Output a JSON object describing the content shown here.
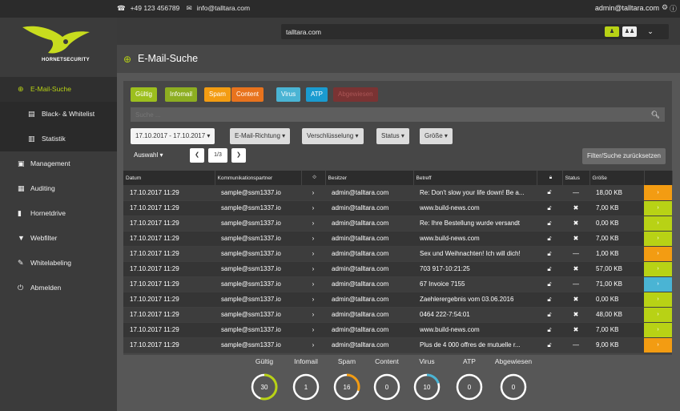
{
  "topbar": {
    "phone": "+49 123 456789",
    "email": "info@talltara.com",
    "user": "admin@talltara.com"
  },
  "logo": {
    "brand": "HORNETSECURITY"
  },
  "nav": [
    {
      "label": "E-Mail-Suche",
      "icon": "search-icon",
      "active": true
    },
    {
      "label": "Black- & Whitelist",
      "icon": "list-icon",
      "sub": true
    },
    {
      "label": "Statistik",
      "icon": "bar-chart-icon",
      "sub": true
    },
    {
      "label": "Management",
      "icon": "id-card-icon"
    },
    {
      "label": "Auditing",
      "icon": "table-icon"
    },
    {
      "label": "Hornetdrive",
      "icon": "file-icon"
    },
    {
      "label": "Webfilter",
      "icon": "filter-icon"
    },
    {
      "label": "Whitelabeling",
      "icon": "edit-icon"
    },
    {
      "label": "Abmelden",
      "icon": "power-icon"
    }
  ],
  "domain": "talltara.com",
  "page_title": "E-Mail-Suche",
  "filters": [
    {
      "label": "Gültig",
      "color": "#9cbf1e"
    },
    {
      "label": "Infomail",
      "color": "#8dae21"
    },
    {
      "label": "Spam",
      "color": "#f39c12"
    },
    {
      "label": "Content",
      "color": "#e8731d"
    },
    {
      "label": "Virus",
      "color": "#4ab4d4"
    },
    {
      "label": "ATP",
      "color": "#1a9bd0"
    },
    {
      "label": "Abgewiesen",
      "color": "#7a3333"
    }
  ],
  "search": {
    "placeholder": "Suche ..."
  },
  "dropdowns": [
    "17.10.2017 - 17.10.2017",
    "E-Mail-Richtung",
    "Verschlüsselung",
    "Status",
    "Größe"
  ],
  "auswahl": "Auswahl",
  "pager": {
    "page": "1/3"
  },
  "reset": "Filter/Suche zurücksetzen",
  "columns": [
    "Datum",
    "Kommunikationspartner",
    "",
    "Besitzer",
    "Betreff",
    "",
    "Status",
    "Größe",
    ""
  ],
  "rows": [
    {
      "date": "17.10.2017 11:29",
      "partner": "sample@ssm1337.io",
      "owner": "admin@talltara.com",
      "subject": "Re: Don't slow your life down! Be a...",
      "status": "—",
      "size": "18,00 KB",
      "color": "#f39c12"
    },
    {
      "date": "17.10.2017 11:29",
      "partner": "sample@ssm1337.io",
      "owner": "admin@talltara.com",
      "subject": "www.build-news.com",
      "status": "✖",
      "size": "7,00 KB",
      "color": "#b8d215"
    },
    {
      "date": "17.10.2017 11:29",
      "partner": "sample@ssm1337.io",
      "owner": "admin@talltara.com",
      "subject": "Re: Ihre Bestellung wurde versandt",
      "status": "✖",
      "size": "0,00 KB",
      "color": "#b8d215"
    },
    {
      "date": "17.10.2017 11:29",
      "partner": "sample@ssm1337.io",
      "owner": "admin@talltara.com",
      "subject": "www.build-news.com",
      "status": "✖",
      "size": "7,00 KB",
      "color": "#b8d215"
    },
    {
      "date": "17.10.2017 11:29",
      "partner": "sample@ssm1337.io",
      "owner": "admin@talltara.com",
      "subject": "Sex und Weihnachten! Ich will dich!",
      "status": "—",
      "size": "1,00 KB",
      "color": "#f39c12"
    },
    {
      "date": "17.10.2017 11:29",
      "partner": "sample@ssm1337.io",
      "owner": "admin@talltara.com",
      "subject": "703 917-10:21:25",
      "status": "✖",
      "size": "57,00 KB",
      "color": "#b8d215"
    },
    {
      "date": "17.10.2017 11:29",
      "partner": "sample@ssm1337.io",
      "owner": "admin@talltara.com",
      "subject": "67 Invoice 7155",
      "status": "—",
      "size": "71,00 KB",
      "color": "#4ab4d4"
    },
    {
      "date": "17.10.2017 11:29",
      "partner": "sample@ssm1337.io",
      "owner": "admin@talltara.com",
      "subject": "Zaehlerergebnis vom 03.06.2016",
      "status": "✖",
      "size": "0,00 KB",
      "color": "#b8d215"
    },
    {
      "date": "17.10.2017 11:29",
      "partner": "sample@ssm1337.io",
      "owner": "admin@talltara.com",
      "subject": "0464 222-7:54:01",
      "status": "✖",
      "size": "48,00 KB",
      "color": "#b8d215"
    },
    {
      "date": "17.10.2017 11:29",
      "partner": "sample@ssm1337.io",
      "owner": "admin@talltara.com",
      "subject": "www.build-news.com",
      "status": "✖",
      "size": "7,00 KB",
      "color": "#b8d215"
    },
    {
      "date": "17.10.2017 11:29",
      "partner": "sample@ssm1337.io",
      "owner": "admin@talltara.com",
      "subject": "Plus de 4 000 offres de mutuelle r...",
      "status": "—",
      "size": "9,00 KB",
      "color": "#f39c12"
    }
  ],
  "stats": [
    {
      "label": "Gültig",
      "value": "30",
      "fraction": 0.55,
      "color": "#b8d215"
    },
    {
      "label": "Infomail",
      "value": "1",
      "fraction": 0,
      "color": "#b8d215"
    },
    {
      "label": "Spam",
      "value": "16",
      "fraction": 0.3,
      "color": "#f39c12"
    },
    {
      "label": "Content",
      "value": "0",
      "fraction": 0,
      "color": "#e8731d"
    },
    {
      "label": "Virus",
      "value": "10",
      "fraction": 0.2,
      "color": "#4ab4d4"
    },
    {
      "label": "ATP",
      "value": "0",
      "fraction": 0,
      "color": "#1a9bd0"
    },
    {
      "label": "Abgewiesen",
      "value": "0",
      "fraction": 0,
      "color": "#7a3333"
    }
  ]
}
